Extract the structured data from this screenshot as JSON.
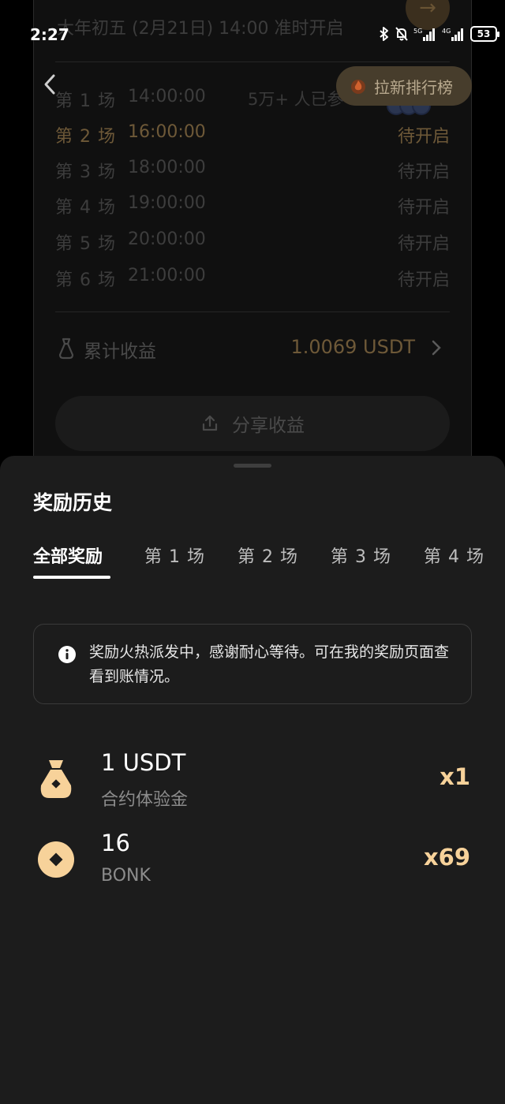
{
  "status_bar": {
    "time": "2:27",
    "battery": "53"
  },
  "background": {
    "open_time": "大年初五 (2月21日) 14:00 准时开启",
    "participants": "5万+ 人已参",
    "rank_button": "拉新排行榜",
    "sessions": [
      {
        "name": "第 1 场",
        "time": "14:00:00",
        "status": ""
      },
      {
        "name": "第 2 场",
        "time": "16:00:00",
        "status": "待开启"
      },
      {
        "name": "第 3 场",
        "time": "18:00:00",
        "status": "待开启"
      },
      {
        "name": "第 4 场",
        "time": "19:00:00",
        "status": "待开启"
      },
      {
        "name": "第 5 场",
        "time": "20:00:00",
        "status": "待开启"
      },
      {
        "name": "第 6 场",
        "time": "21:00:00",
        "status": "待开启"
      }
    ],
    "earnings_label": "累计收益",
    "earnings_value": "1.0069 USDT",
    "share_label": "分享收益"
  },
  "sheet": {
    "title": "奖励历史",
    "tabs": [
      "全部奖励",
      "第 1 场",
      "第 2 场",
      "第 3 场",
      "第 4 场"
    ],
    "notice": "奖励火热派发中，感谢耐心等待。可在我的奖励页面查看到账情况。",
    "rewards": [
      {
        "amount": "1 USDT",
        "name": "合约体验金",
        "count": "x1",
        "icon": "money-bag-icon"
      },
      {
        "amount": "16",
        "name": "BONK",
        "count": "x69",
        "icon": "coin-icon"
      }
    ]
  },
  "colors": {
    "accent": "#f7d29a",
    "sheet_bg": "#1c1c1c",
    "dim_gold": "#6e5938"
  }
}
